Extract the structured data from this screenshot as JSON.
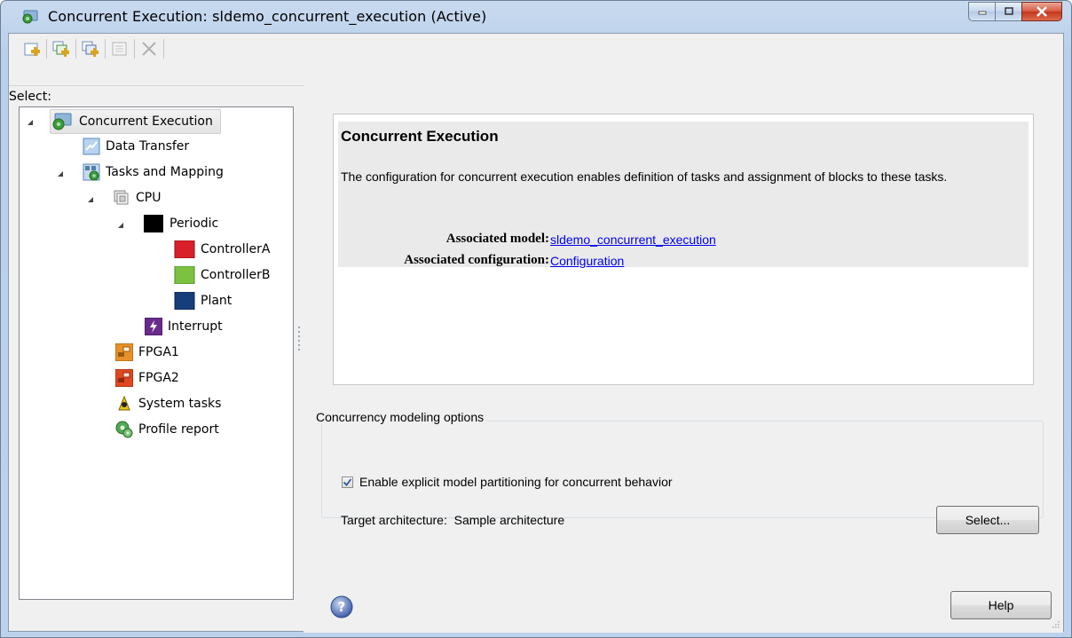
{
  "window": {
    "title": "Concurrent Execution: sldemo_concurrent_execution (Active)",
    "colors": {
      "titlebar": "#bcd2ec",
      "link": "#0000ee",
      "close": "#c3361c"
    }
  },
  "toolbar": {
    "buttons": [
      "add-task-icon",
      "add-periodic-icon",
      "add-interrupt-icon",
      "add-disabled-icon",
      "delete-icon"
    ]
  },
  "tree": {
    "label": "Select:",
    "items": [
      {
        "label": "Concurrent Execution",
        "icon": "concurrent-execution-icon"
      },
      {
        "label": "Data Transfer",
        "icon": "data-transfer-icon"
      },
      {
        "label": "Tasks and Mapping",
        "icon": "tasks-mapping-icon"
      },
      {
        "label": "CPU",
        "icon": "cpu-icon"
      },
      {
        "label": "Periodic",
        "icon": "periodic-icon"
      },
      {
        "label": "ControllerA",
        "icon": "controllera-icon"
      },
      {
        "label": "ControllerB",
        "icon": "controllerb-icon"
      },
      {
        "label": "Plant",
        "icon": "plant-icon"
      },
      {
        "label": "Interrupt",
        "icon": "interrupt-icon"
      },
      {
        "label": "FPGA1",
        "icon": "fpga1-icon"
      },
      {
        "label": "FPGA2",
        "icon": "fpga2-icon"
      },
      {
        "label": "System tasks",
        "icon": "system-tasks-icon"
      },
      {
        "label": "Profile report",
        "icon": "profile-report-icon"
      }
    ]
  },
  "info": {
    "title": "Concurrent Execution",
    "description": "The configuration for concurrent execution enables definition of tasks and assignment of blocks to these tasks.",
    "associated_model_label": "Associated model:",
    "associated_model_link": "sldemo_concurrent_execution",
    "associated_configuration_label": "Associated configuration:",
    "associated_configuration_link": "Configuration"
  },
  "options": {
    "legend": "Concurrency modeling options",
    "checkbox_label": "Enable explicit model partitioning for concurrent behavior",
    "checkbox_checked": true,
    "target_label": "Target architecture:",
    "target_value": "Sample architecture",
    "select_button": "Select..."
  },
  "footer": {
    "help_button": "Help"
  }
}
